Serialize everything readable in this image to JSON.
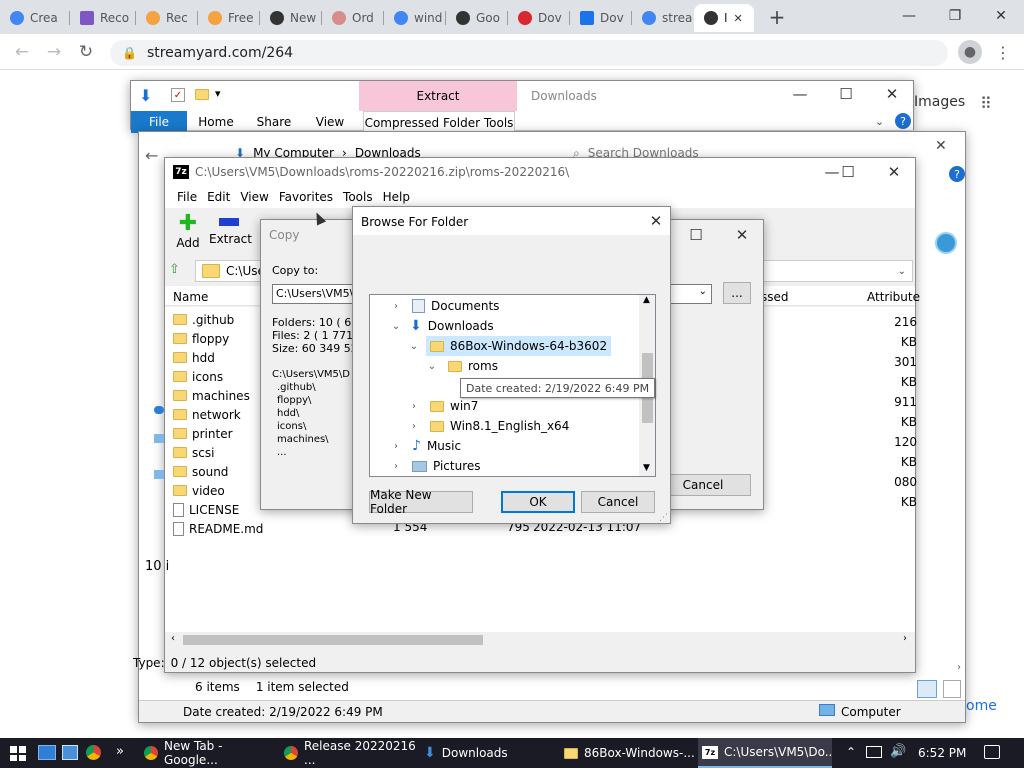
{
  "browser": {
    "tabs": [
      {
        "label": "Crea",
        "color": "#4285f4"
      },
      {
        "label": "Reco",
        "color": "#7e57c2"
      },
      {
        "label": "Rec",
        "color": "#f4a340"
      },
      {
        "label": "Free",
        "color": "#f4a340"
      },
      {
        "label": "New",
        "color": "#333333"
      },
      {
        "label": "Ord",
        "color": "#d98c8c"
      },
      {
        "label": "wind",
        "color": "#4285f4"
      },
      {
        "label": "Goo",
        "color": "#333333"
      },
      {
        "label": "Dov",
        "color": "#d9282f"
      },
      {
        "label": "Dov",
        "color": "#1a73e8"
      },
      {
        "label": "strea",
        "color": "#4285f4"
      },
      {
        "label": "I",
        "color": "#333333"
      }
    ],
    "active_tab_close": "✕",
    "new_tab": "+",
    "url": "streamyard.com/264",
    "page_right_text_1": "Images",
    "page_right_text_2": "ome"
  },
  "explorer": {
    "title": "Downloads",
    "extract_tab": "Extract",
    "ribbon_tabs": [
      "File",
      "Home",
      "Share",
      "View",
      "Compressed Folder Tools"
    ],
    "breadcrumb": [
      "My Computer",
      "Downloads"
    ],
    "search_placeholder": "Search Downloads",
    "status_items": "6 items",
    "status_selected": "1 item selected",
    "details_left": "Date created: 2/19/2022 6:49 PM",
    "details_right": "Computer"
  },
  "sevenzip": {
    "title": "C:\\Users\\VM5\\Downloads\\roms-20220216.zip\\roms-20220216\\",
    "menu": [
      "File",
      "Edit",
      "View",
      "Favorites",
      "Tools",
      "Help"
    ],
    "toolbar": {
      "add": "Add",
      "extract": "Extract"
    },
    "path": "C:\\User",
    "columns": {
      "name": "Name",
      "packed": "ssed",
      "attributes": "Attribute"
    },
    "files": [
      {
        "name": ".github",
        "type": "folder"
      },
      {
        "name": "floppy",
        "type": "folder"
      },
      {
        "name": "hdd",
        "type": "folder"
      },
      {
        "name": "icons",
        "type": "folder"
      },
      {
        "name": "machines",
        "type": "folder"
      },
      {
        "name": "network",
        "type": "folder"
      },
      {
        "name": "printer",
        "type": "folder"
      },
      {
        "name": "scsi",
        "type": "folder"
      },
      {
        "name": "sound",
        "type": "folder"
      },
      {
        "name": "video",
        "type": "folder"
      },
      {
        "name": "LICENSE",
        "type": "file"
      },
      {
        "name": "README.md",
        "type": "file",
        "size": "1 554",
        "packed": "795",
        "modified": "2022-02-13 11:07"
      }
    ],
    "sizes": [
      "216 KB",
      "301 KB",
      "911 KB",
      "120 KB",
      "080 KB"
    ],
    "count_short": "10 i",
    "status_left": "Type:",
    "status": "0 / 12 object(s) selected"
  },
  "copy_dialog": {
    "title": "Copy",
    "copy_to_label": "Copy to:",
    "path_value": "C:\\Users\\VM5\\D",
    "browse_button": "...",
    "folders": "Folders: 10    ( 60",
    "files": "Files: 2    ( 1 771",
    "size": "Size: 60 349 522",
    "list_path": "C:\\Users\\VM5\\D",
    "list_items": [
      ".github\\",
      "floppy\\",
      "hdd\\",
      "icons\\",
      "machines\\",
      "..."
    ],
    "cancel": "Cancel"
  },
  "browse_dialog": {
    "title": "Browse For Folder",
    "tree": {
      "documents": "Documents",
      "downloads": "Downloads",
      "selected": "86Box-Windows-64-b3602",
      "roms": "roms",
      "win7": "win7",
      "win81": "Win8.1_English_x64",
      "music": "Music",
      "pictures": "Pictures"
    },
    "tooltip": "Date created: 2/19/2022 6:49 PM",
    "make_new_folder": "Make New Folder",
    "ok": "OK",
    "cancel": "Cancel"
  },
  "taskbar": {
    "items": [
      {
        "label": "New Tab - Google..."
      },
      {
        "label": "Release 20220216 ..."
      },
      {
        "label": "Downloads"
      },
      {
        "label": "86Box-Windows-..."
      },
      {
        "label": "C:\\Users\\VM5\\Do..."
      }
    ],
    "overflow": "»",
    "time": "6:52 PM"
  }
}
